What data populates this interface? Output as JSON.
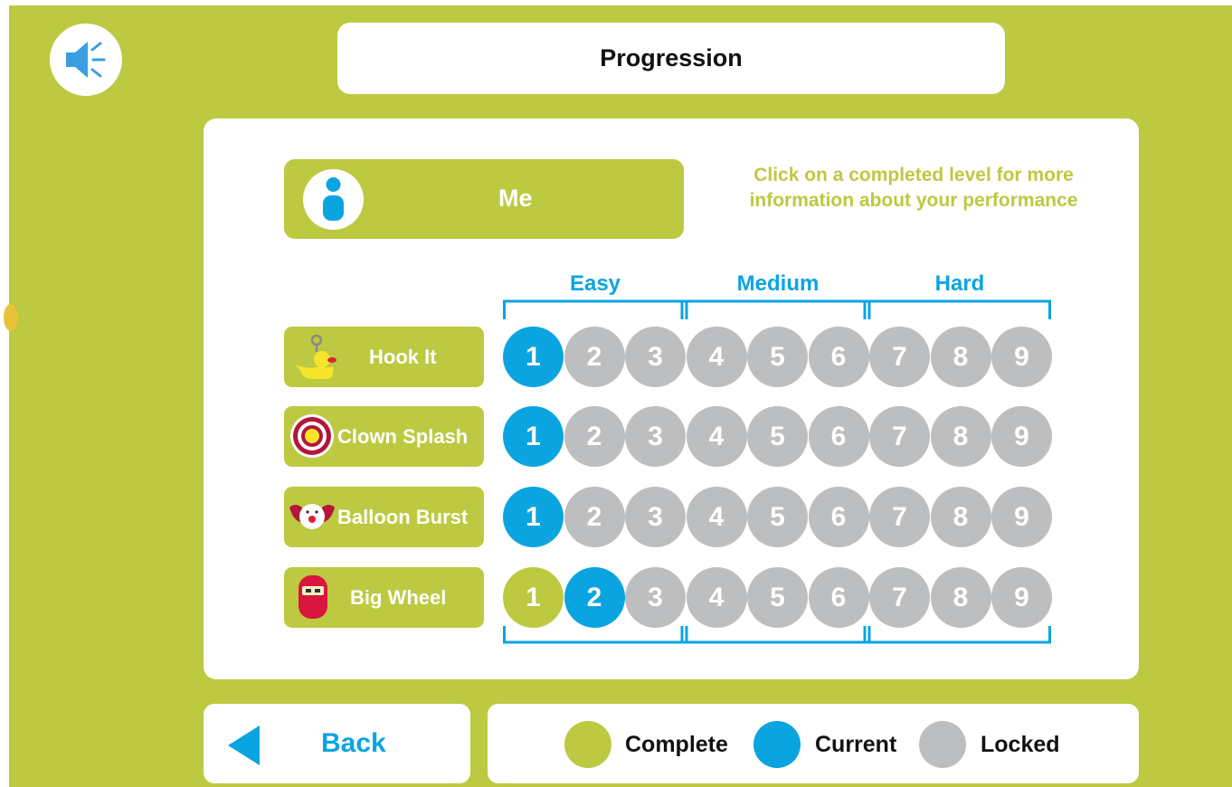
{
  "header": {
    "title": "Progression",
    "sound_icon": "speaker-icon"
  },
  "profile": {
    "name": "Me",
    "icon": "person-icon"
  },
  "hint": "Click on a completed level for more information about your performance",
  "difficulty_bands": [
    "Easy",
    "Medium",
    "Hard"
  ],
  "colors": {
    "complete": "#bdc940",
    "current": "#0aa5e0",
    "locked": "#bcbec0"
  },
  "games": [
    {
      "name": "Hook It",
      "icon": "duck-icon",
      "levels": [
        "1",
        "2",
        "3",
        "4",
        "5",
        "6",
        "7",
        "8",
        "9"
      ],
      "status": [
        "current",
        "locked",
        "locked",
        "locked",
        "locked",
        "locked",
        "locked",
        "locked",
        "locked"
      ]
    },
    {
      "name": "Clown Splash",
      "icon": "target-icon",
      "levels": [
        "1",
        "2",
        "3",
        "4",
        "5",
        "6",
        "7",
        "8",
        "9"
      ],
      "status": [
        "current",
        "locked",
        "locked",
        "locked",
        "locked",
        "locked",
        "locked",
        "locked",
        "locked"
      ]
    },
    {
      "name": "Balloon Burst",
      "icon": "clown-icon",
      "levels": [
        "1",
        "2",
        "3",
        "4",
        "5",
        "6",
        "7",
        "8",
        "9"
      ],
      "status": [
        "current",
        "locked",
        "locked",
        "locked",
        "locked",
        "locked",
        "locked",
        "locked",
        "locked"
      ]
    },
    {
      "name": "Big Wheel",
      "icon": "robot-icon",
      "levels": [
        "1",
        "2",
        "3",
        "4",
        "5",
        "6",
        "7",
        "8",
        "9"
      ],
      "status": [
        "complete",
        "current",
        "locked",
        "locked",
        "locked",
        "locked",
        "locked",
        "locked",
        "locked"
      ]
    }
  ],
  "footer": {
    "back_label": "Back",
    "legend": {
      "complete": "Complete",
      "current": "Current",
      "locked": "Locked"
    }
  }
}
